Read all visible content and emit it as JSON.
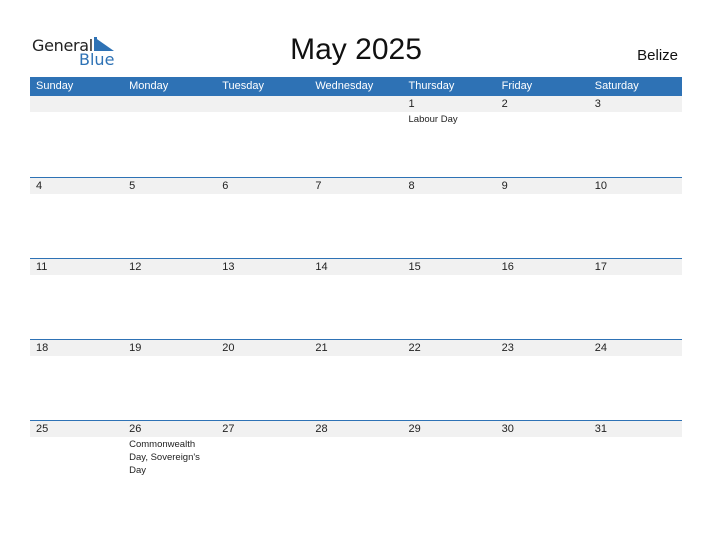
{
  "logo": {
    "line1": "General",
    "line2": "Blue"
  },
  "title": "May 2025",
  "country": "Belize",
  "weekdays": [
    "Sunday",
    "Monday",
    "Tuesday",
    "Wednesday",
    "Thursday",
    "Friday",
    "Saturday"
  ],
  "weeks": [
    {
      "days": [
        "",
        "",
        "",
        "",
        "1",
        "2",
        "3"
      ],
      "events": [
        "",
        "",
        "",
        "",
        "Labour Day",
        "",
        ""
      ]
    },
    {
      "days": [
        "4",
        "5",
        "6",
        "7",
        "8",
        "9",
        "10"
      ],
      "events": [
        "",
        "",
        "",
        "",
        "",
        "",
        ""
      ]
    },
    {
      "days": [
        "11",
        "12",
        "13",
        "14",
        "15",
        "16",
        "17"
      ],
      "events": [
        "",
        "",
        "",
        "",
        "",
        "",
        ""
      ]
    },
    {
      "days": [
        "18",
        "19",
        "20",
        "21",
        "22",
        "23",
        "24"
      ],
      "events": [
        "",
        "",
        "",
        "",
        "",
        "",
        ""
      ]
    },
    {
      "days": [
        "25",
        "26",
        "27",
        "28",
        "29",
        "30",
        "31"
      ],
      "events": [
        "",
        "Commonwealth Day, Sovereign's Day",
        "",
        "",
        "",
        "",
        ""
      ]
    }
  ],
  "colors": {
    "accent": "#2e72b5",
    "day_bar": "#f1f1f1"
  }
}
